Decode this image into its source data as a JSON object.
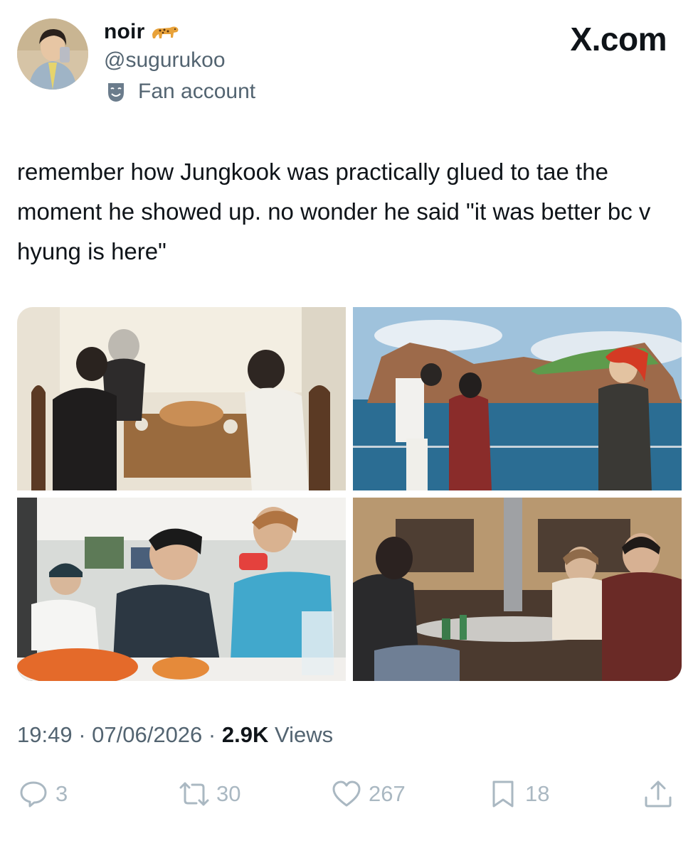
{
  "header": {
    "display_name": "noir",
    "handle": "@sugurukoo",
    "account_label": "Fan account",
    "brand": "X.com"
  },
  "tweet": {
    "text": "remember how Jungkook was practically glued to tae the moment he showed up. no wonder he said \"it was better bc v hyung is here\""
  },
  "meta": {
    "time": "19:49",
    "date": "07/06/2026",
    "views_count": "2.9K",
    "views_label": "Views"
  },
  "actions": {
    "replies": "3",
    "reposts": "30",
    "likes": "267",
    "bookmarks": "18"
  },
  "icons": {
    "verified_emoji": "leopard-icon",
    "label_icon": "theater-mask-icon",
    "reply": "reply-icon",
    "repost": "repost-icon",
    "like": "heart-icon",
    "bookmark": "bookmark-icon",
    "share": "share-icon"
  },
  "colors": {
    "text_primary": "#0f1419",
    "text_secondary": "#536471",
    "action_icon": "#aab8c2"
  }
}
